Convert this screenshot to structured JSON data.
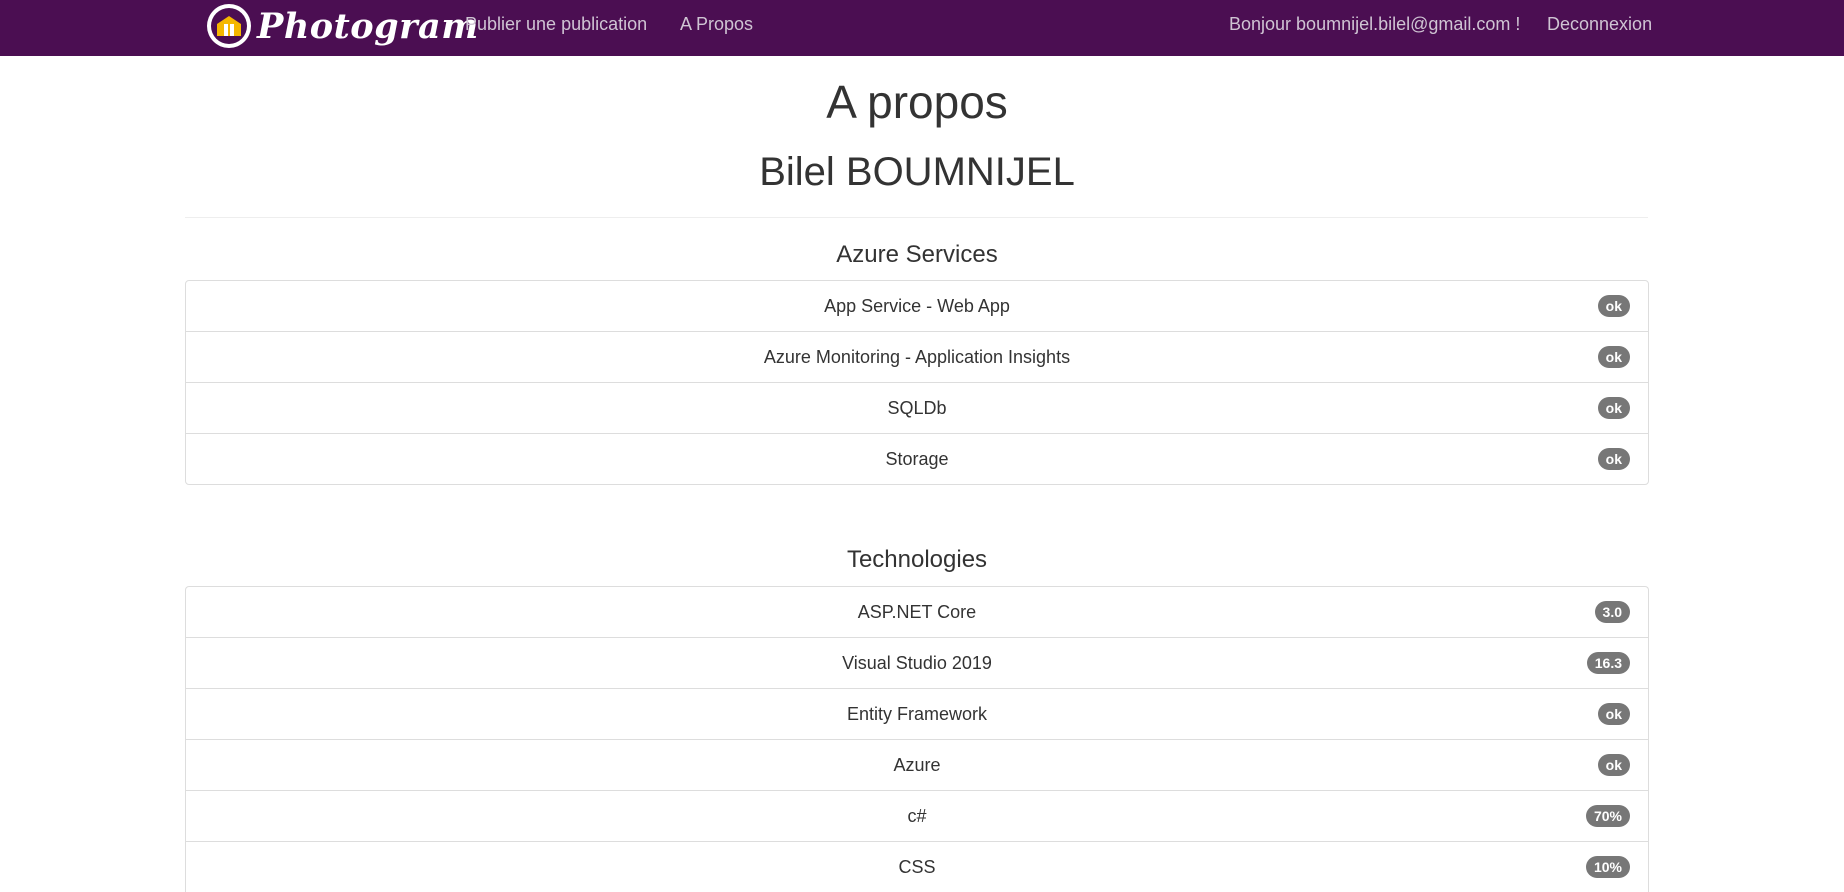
{
  "navbar": {
    "brand_name": "Photogram",
    "links": {
      "publish": "Publier une publication",
      "about": "A Propos"
    },
    "greeting": "Bonjour boumnijel.bilel@gmail.com !",
    "logout": "Deconnexion",
    "colors": {
      "background": "#4b0e52",
      "logo_accent": "#f5b700"
    }
  },
  "page": {
    "title": "A propos",
    "name": "Bilel BOUMNIJEL"
  },
  "azure_section": {
    "title": "Azure Services",
    "items": [
      {
        "label": "App Service - Web App",
        "badge": "ok"
      },
      {
        "label": "Azure Monitoring - Application Insights",
        "badge": "ok"
      },
      {
        "label": "SQLDb",
        "badge": "ok"
      },
      {
        "label": "Storage",
        "badge": "ok"
      }
    ]
  },
  "tech_section": {
    "title": "Technologies",
    "items": [
      {
        "label": "ASP.NET Core",
        "badge": "3.0"
      },
      {
        "label": "Visual Studio 2019",
        "badge": "16.3"
      },
      {
        "label": "Entity Framework",
        "badge": "ok"
      },
      {
        "label": "Azure",
        "badge": "ok"
      },
      {
        "label": "c#",
        "badge": "70%"
      },
      {
        "label": "CSS",
        "badge": "10%"
      }
    ]
  }
}
